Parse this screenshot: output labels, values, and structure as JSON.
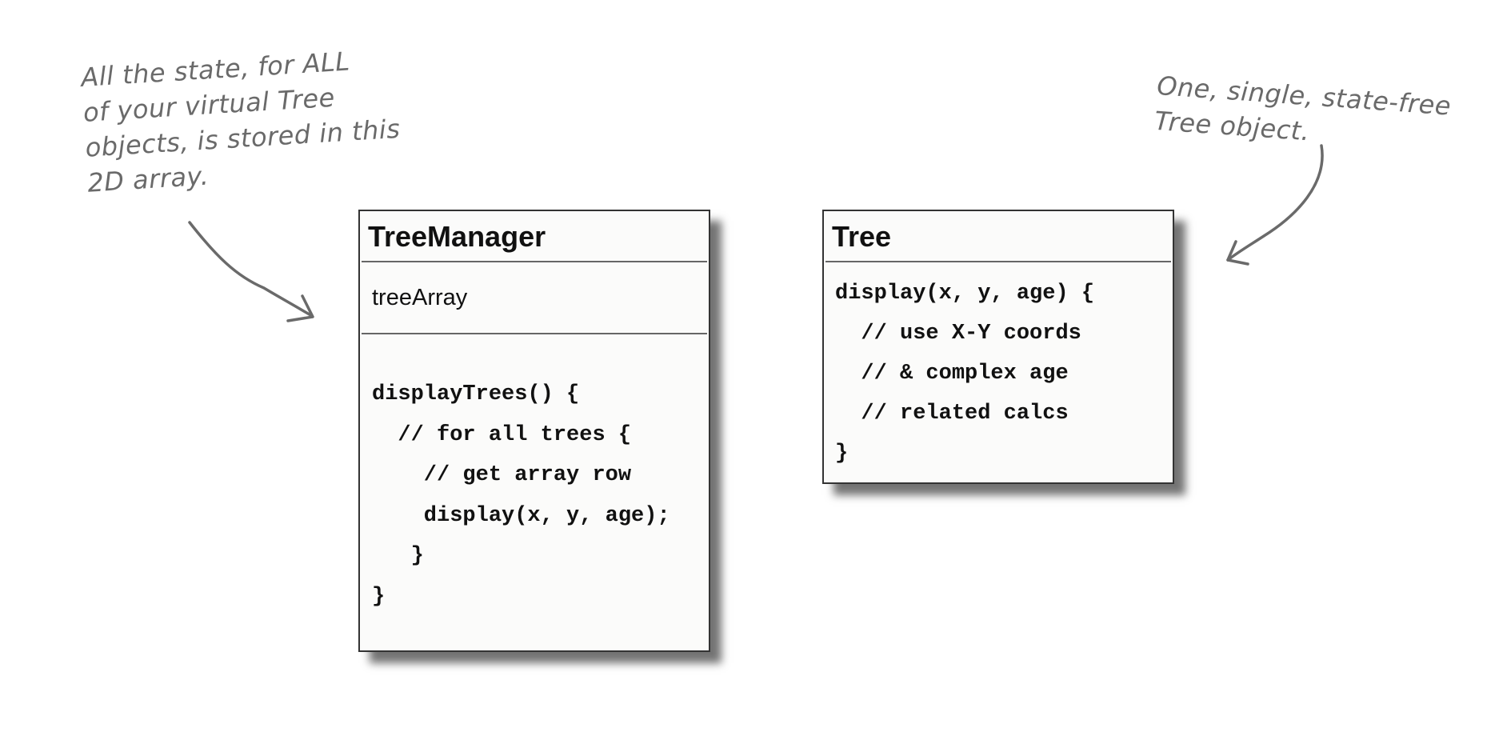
{
  "annotations": {
    "left": "All the state, for ALL\nof your virtual Tree\nobjects, is stored in this\n2D array.",
    "right": "One, single, state-free\nTree object."
  },
  "classes": {
    "tree_manager": {
      "name": "TreeManager",
      "attribute": "treeArray",
      "method_code": "displayTrees() {\n  // for all trees {\n    // get array row\n    display(x, y, age);\n   }\n}"
    },
    "tree": {
      "name": "Tree",
      "method_code": "display(x, y, age) {\n  // use X-Y coords\n  // & complex age\n  // related calcs\n}"
    }
  },
  "colors": {
    "annotation": "#6a6a6a",
    "box_border": "#333333",
    "box_fill": "#fbfbfa"
  }
}
